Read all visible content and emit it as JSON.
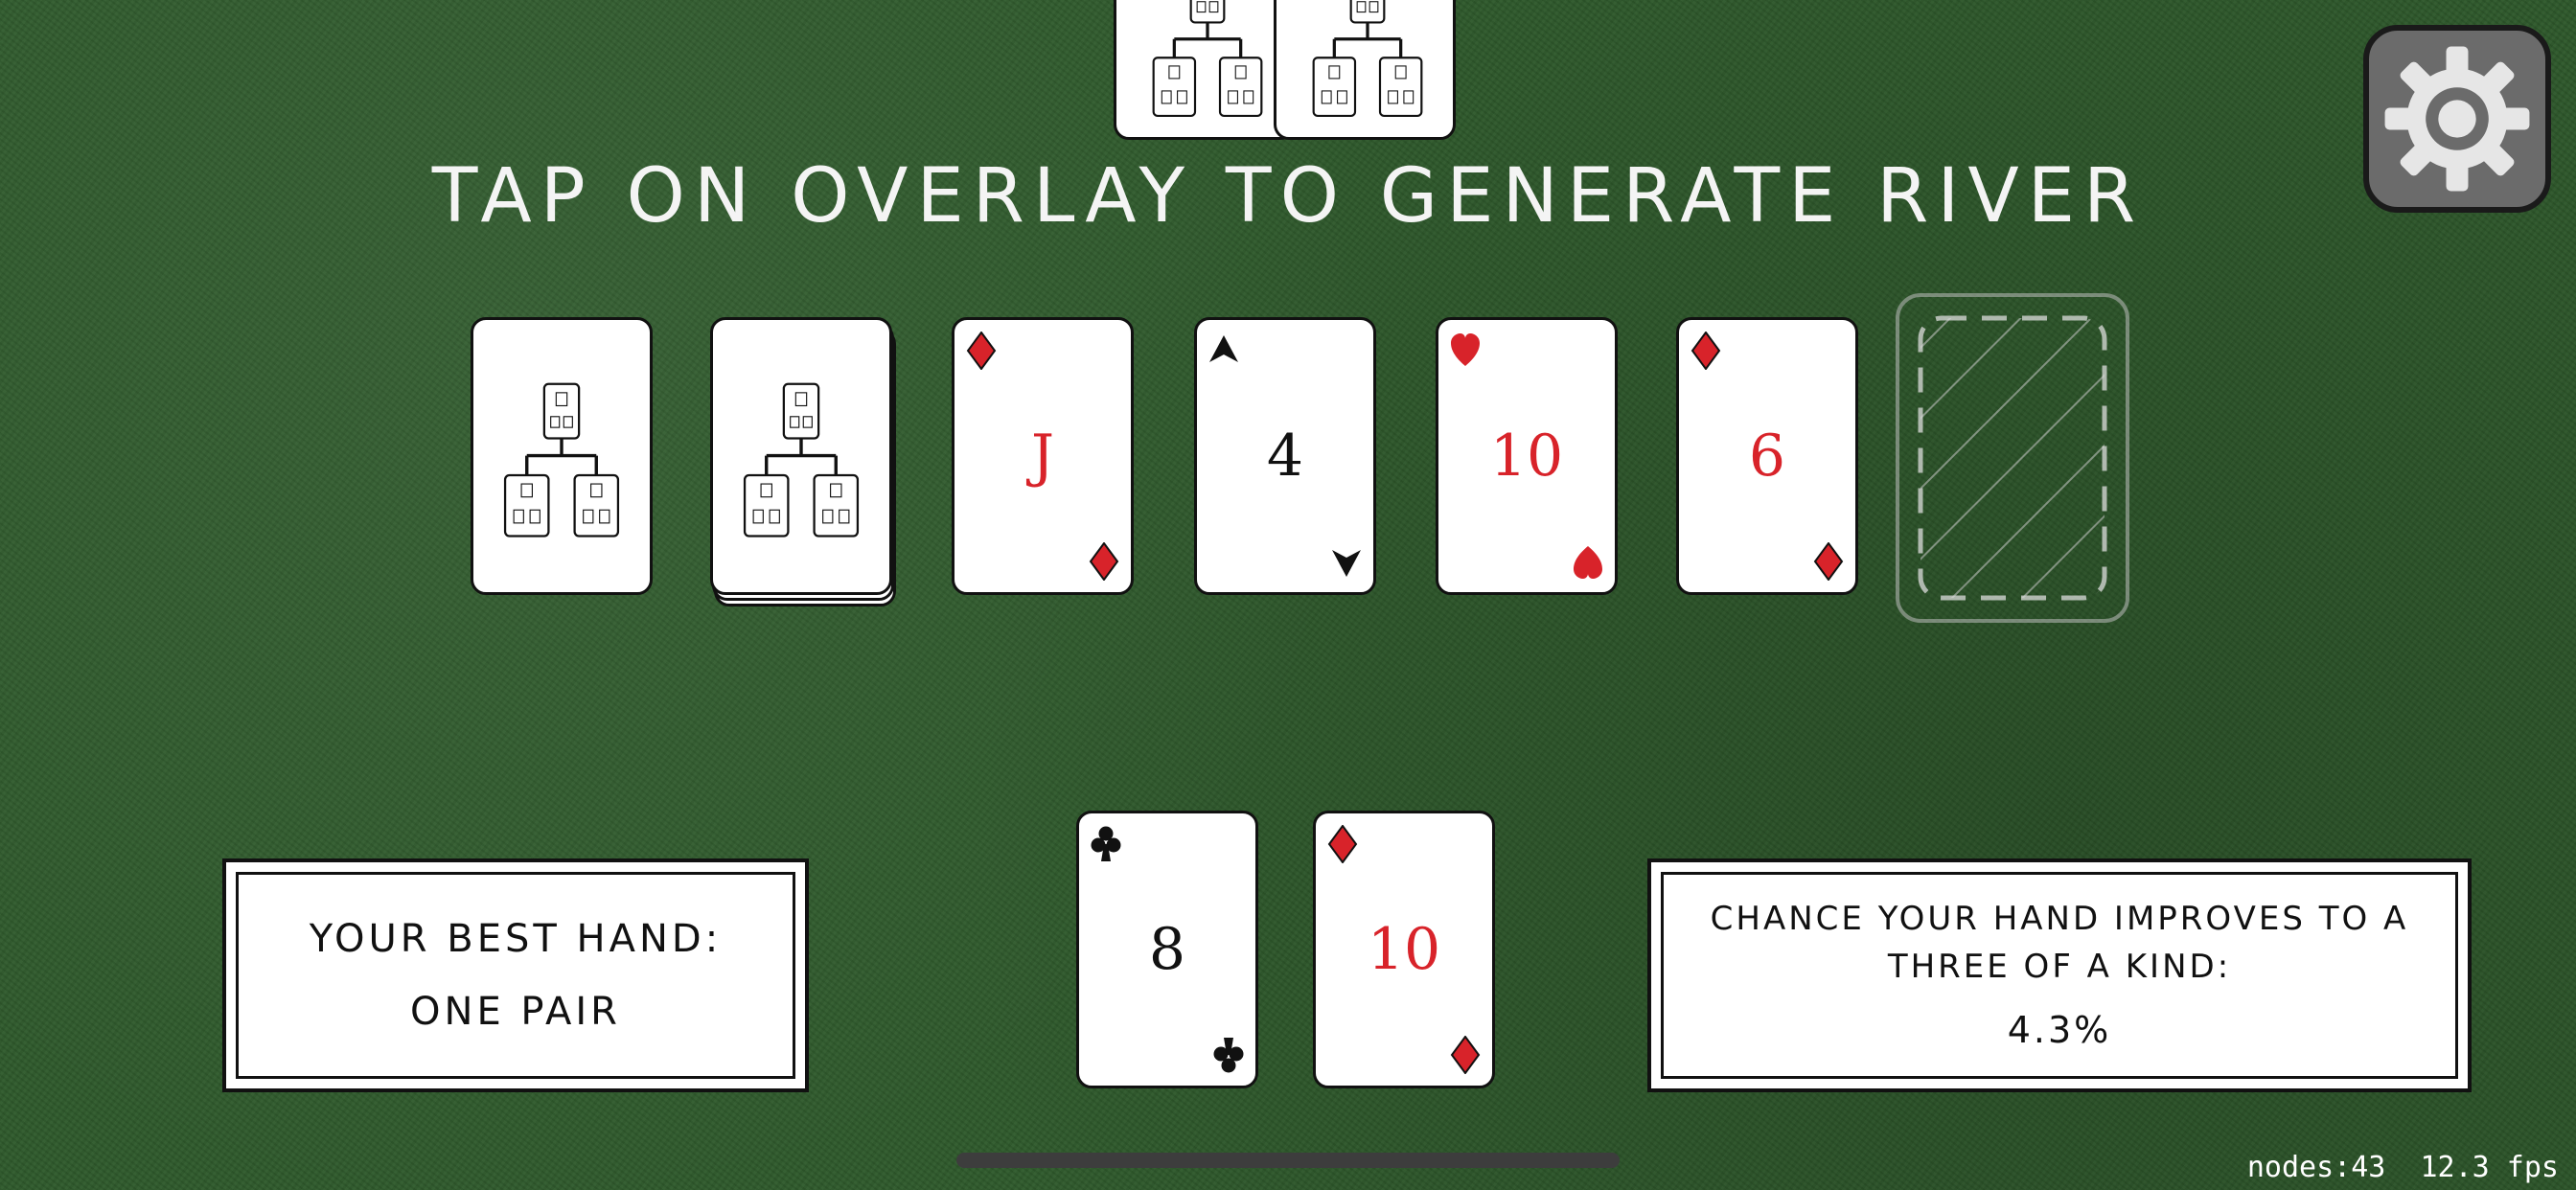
{
  "instruction": "TAP ON OVERLAY TO GENERATE RIVER",
  "opponent_cards": [
    {
      "face": "back"
    },
    {
      "face": "back"
    }
  ],
  "board": {
    "deck_cards": [
      {
        "face": "back"
      },
      {
        "face": "back-stack"
      }
    ],
    "community_cards": [
      {
        "rank": "J",
        "suit": "diamonds",
        "color": "red"
      },
      {
        "rank": "4",
        "suit": "spades",
        "color": "black"
      },
      {
        "rank": "10",
        "suit": "hearts",
        "color": "red"
      },
      {
        "rank": "6",
        "suit": "diamonds",
        "color": "red"
      }
    ],
    "river_slot": "empty"
  },
  "player_hand": [
    {
      "rank": "8",
      "suit": "clubs",
      "color": "black"
    },
    {
      "rank": "10",
      "suit": "diamonds",
      "color": "red"
    }
  ],
  "best_hand_panel": {
    "label": "YOUR BEST HAND:",
    "value": "ONE PAIR"
  },
  "odds_panel": {
    "line1": "CHANCE YOUR HAND IMPROVES TO A",
    "line2": "THREE OF A KIND:",
    "value": "4.3%"
  },
  "settings": {
    "icon": "gear-icon"
  },
  "debug": {
    "nodes": "nodes:43",
    "fps": "12.3 fps"
  },
  "colors": {
    "felt": "#2f5a2c",
    "red_suit": "#d8232a",
    "black_suit": "#111111"
  }
}
